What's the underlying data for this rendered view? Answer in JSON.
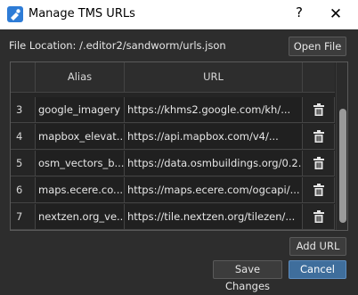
{
  "window": {
    "title": "Manage TMS URLs",
    "help_label": "?",
    "close_label": "✕"
  },
  "file_location": {
    "text": "File Location: /.editor2/sandworm/urls.json",
    "open_button": "Open File"
  },
  "table": {
    "columns": [
      "",
      "Alias",
      "URL",
      ""
    ],
    "rows": [
      {
        "index": "3",
        "alias": "google_imagery",
        "url": "https://khms2.google.com/kh/..."
      },
      {
        "index": "4",
        "alias": "mapbox_elevat...",
        "url": "https://api.mapbox.com/v4/..."
      },
      {
        "index": "5",
        "alias": "osm_vectors_b...",
        "url": "https://data.osmbuildings.org/0.2..."
      },
      {
        "index": "6",
        "alias": "maps.ecere.co...",
        "url": "https://maps.ecere.com/ogcapi/..."
      },
      {
        "index": "7",
        "alias": "nextzen.org_ve...",
        "url": "https://tile.nextzen.org/tilezen/..."
      }
    ]
  },
  "buttons": {
    "add_url": "Add URL",
    "save_changes": "Save Changes",
    "cancel": "Cancel"
  },
  "icons": {
    "app": "app-icon",
    "delete": "trash-icon"
  },
  "colors": {
    "background": "#2d2d2d",
    "primary_button": "#3f6e9c",
    "titlebar": "#ffffff"
  }
}
